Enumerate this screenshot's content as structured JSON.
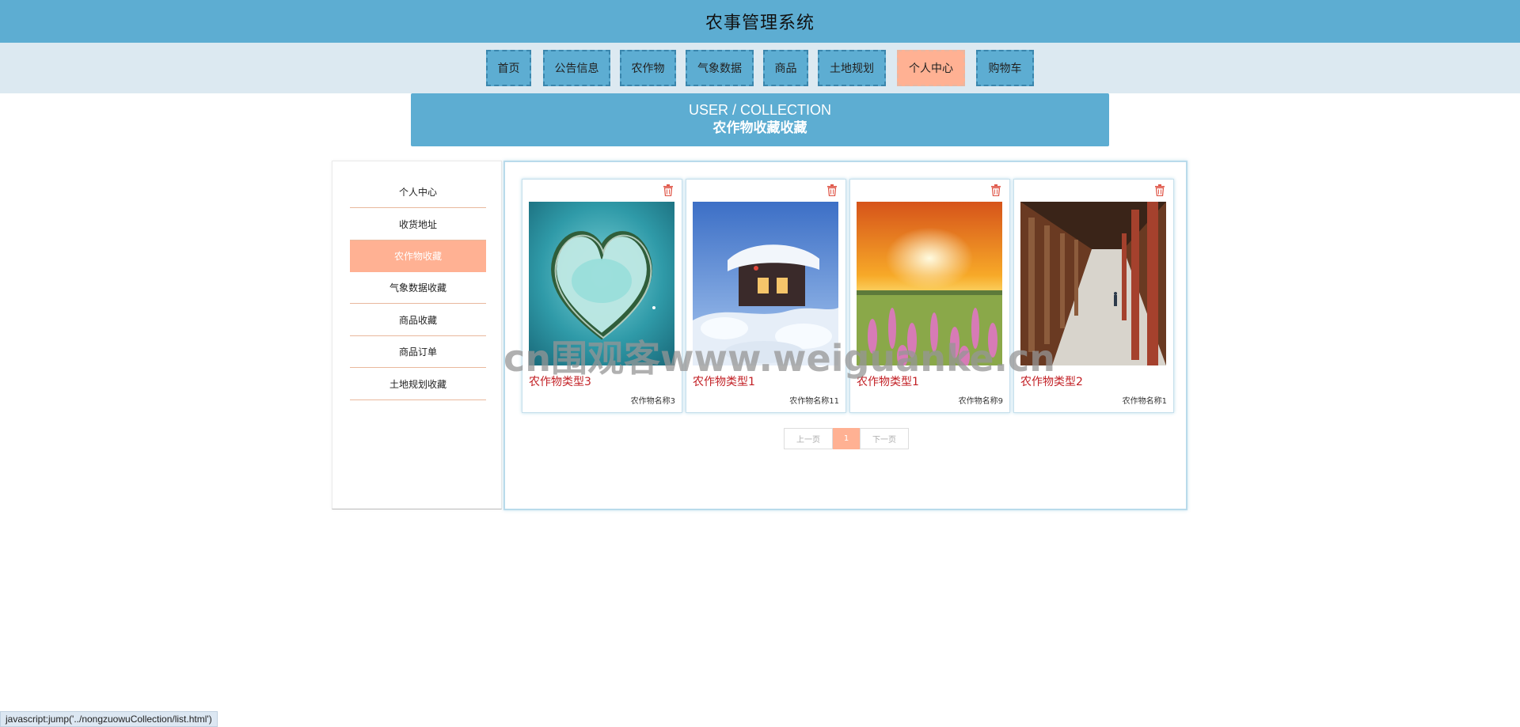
{
  "header": {
    "title": "农事管理系统"
  },
  "nav": {
    "items": [
      {
        "label": "首页"
      },
      {
        "label": "公告信息"
      },
      {
        "label": "农作物"
      },
      {
        "label": "气象数据"
      },
      {
        "label": "商品"
      },
      {
        "label": "土地规划"
      },
      {
        "label": "个人中心"
      },
      {
        "label": "购物车"
      }
    ],
    "active": "个人中心"
  },
  "banner": {
    "en": "USER / COLLECTION",
    "cn": "农作物收藏收藏"
  },
  "sidebar": {
    "items": [
      {
        "label": "个人中心"
      },
      {
        "label": "收货地址"
      },
      {
        "label": "农作物收藏"
      },
      {
        "label": "气象数据收藏"
      },
      {
        "label": "商品收藏"
      },
      {
        "label": "商品订单"
      },
      {
        "label": "土地规划收藏"
      }
    ],
    "active": "农作物收藏"
  },
  "cards": [
    {
      "type": "农作物类型3",
      "name": "农作物名称3",
      "image": "heart-island"
    },
    {
      "type": "农作物类型1",
      "name": "农作物名称11",
      "image": "snow-cabin"
    },
    {
      "type": "农作物类型1",
      "name": "农作物名称9",
      "image": "sunset-flowers"
    },
    {
      "type": "农作物类型2",
      "name": "农作物名称1",
      "image": "temple-corridor"
    }
  ],
  "pager": {
    "prev": "上一页",
    "current": "1",
    "next": "下一页"
  },
  "watermark": "cn围观客www.weiguanke.cn",
  "statusbar": {
    "text": "javascript:jump('../nongzuowuCollection/list.html')"
  },
  "colors": {
    "primary": "#5dadd2",
    "accent": "#ffb193",
    "navbar_bg": "#dce9f1",
    "card_title": "#c21f24"
  }
}
